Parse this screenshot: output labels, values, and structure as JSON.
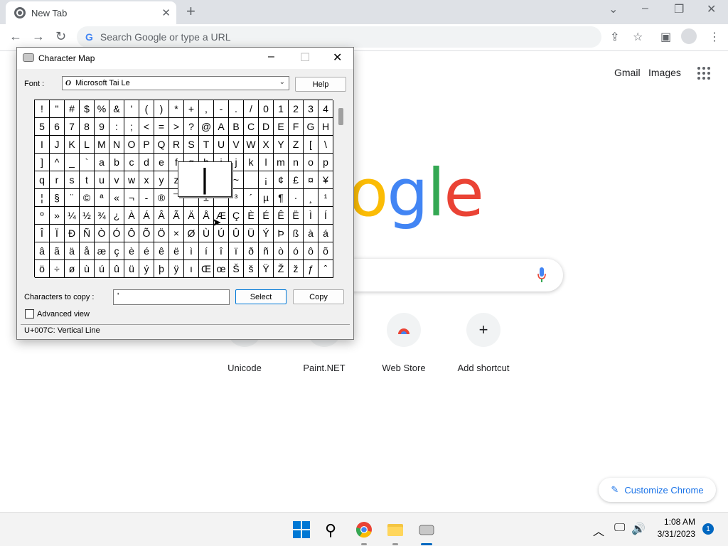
{
  "chrome": {
    "tab_title": "New Tab",
    "omnibox_placeholder": "Search Google or type a URL",
    "top_links": [
      "Gmail",
      "Images"
    ],
    "logo_letters": [
      {
        "ch": "o",
        "color": "#fbbc05"
      },
      {
        "ch": "g",
        "color": "#4285f4"
      },
      {
        "ch": "l",
        "color": "#34a853"
      },
      {
        "ch": "e",
        "color": "#ea4335"
      }
    ],
    "shortcuts": [
      {
        "label": "Unicode",
        "icon": "unicode-icon"
      },
      {
        "label": "Paint.NET",
        "icon": "paintnet-icon"
      },
      {
        "label": "Web Store",
        "icon": "webstore-icon"
      },
      {
        "label": "Add shortcut",
        "icon": "plus-icon",
        "glyph": "+"
      }
    ],
    "customize_label": "Customize Chrome"
  },
  "charmap": {
    "title": "Character Map",
    "font_label": "Font :",
    "font_value": "Microsoft Tai Le",
    "help_label": "Help",
    "chars": [
      "!",
      "\"",
      "#",
      "$",
      "%",
      "&",
      "'",
      "(",
      ")",
      "*",
      "+",
      ",",
      "-",
      ".",
      "/",
      "0",
      "1",
      "2",
      "3",
      "4",
      "5",
      "6",
      "7",
      "8",
      "9",
      ":",
      ";",
      "<",
      "=",
      ">",
      "?",
      "@",
      "A",
      "B",
      "C",
      "D",
      "E",
      "F",
      "G",
      "H",
      "I",
      "J",
      "K",
      "L",
      "M",
      "N",
      "O",
      "P",
      "Q",
      "R",
      "S",
      "T",
      "U",
      "V",
      "W",
      "X",
      "Y",
      "Z",
      "[",
      "\\",
      "]",
      "^",
      "_",
      "`",
      "a",
      "b",
      "c",
      "d",
      "e",
      "f",
      "g",
      "h",
      "i",
      "j",
      "k",
      "l",
      "m",
      "n",
      "o",
      "p",
      "q",
      "r",
      "s",
      "t",
      "u",
      "v",
      "w",
      "x",
      "y",
      "z",
      "{",
      "|",
      "}",
      "~",
      " ",
      "¡",
      "¢",
      "£",
      "¤",
      "¥",
      "¦",
      "§",
      "¨",
      "©",
      "ª",
      "«",
      "¬",
      "-",
      "®",
      "¯",
      "°",
      "±",
      "²",
      "³",
      "´",
      "µ",
      "¶",
      "·",
      "¸",
      "¹",
      "º",
      "»",
      "¼",
      "½",
      "¾",
      "¿",
      "À",
      "Á",
      "Â",
      "Ã",
      "Ä",
      "Å",
      "Æ",
      "Ç",
      "È",
      "É",
      "Ê",
      "Ë",
      "Ì",
      "Í",
      "Î",
      "Ï",
      "Ð",
      "Ñ",
      "Ò",
      "Ó",
      "Ô",
      "Õ",
      "Ö",
      "×",
      "Ø",
      "Ù",
      "Ú",
      "Û",
      "Ü",
      "Ý",
      "Þ",
      "ß",
      "à",
      "á",
      "â",
      "ã",
      "ä",
      "å",
      "æ",
      "ç",
      "è",
      "é",
      "ê",
      "ë",
      "ì",
      "í",
      "î",
      "ï",
      "ð",
      "ñ",
      "ò",
      "ó",
      "ô",
      "õ",
      "ö",
      "÷",
      "ø",
      "ù",
      "ú",
      "û",
      "ü",
      "ý",
      "þ",
      "ÿ",
      "ı",
      "Œ",
      "œ",
      "Š",
      "š",
      "Ÿ",
      "Ž",
      "ž",
      "ƒ",
      "ˆ"
    ],
    "zoom_char": "|",
    "copy_label": "Characters to copy :",
    "copy_value": "ʹ",
    "select_label": "Select",
    "copy_button_label": "Copy",
    "advanced_label": "Advanced view",
    "status": "U+007C: Vertical Line"
  },
  "taskbar": {
    "time": "1:08 AM",
    "date": "3/31/2023",
    "notifications": "1"
  }
}
